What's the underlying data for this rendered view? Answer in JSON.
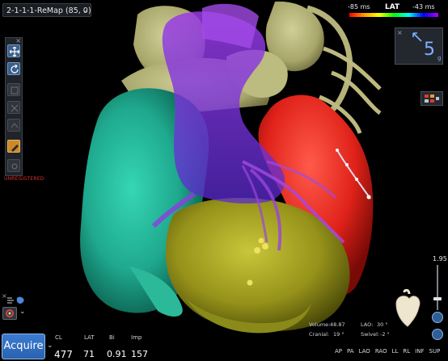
{
  "map_selector": {
    "label": "2-1-1-1-ReMap (85, 0)",
    "chevron_icon": "chevron-down-icon"
  },
  "toolbar": {
    "close_label": "×",
    "buttons": [
      {
        "icon": "pan-move-icon",
        "state": "on"
      },
      {
        "icon": "rotate-icon",
        "state": "on"
      },
      {
        "icon": "tool-disabled-icon",
        "state": "off"
      },
      {
        "icon": "tool-disabled-icon",
        "state": "off"
      },
      {
        "icon": "tool-disabled-icon",
        "state": "off"
      },
      {
        "icon": "pencil-icon",
        "state": "gold"
      },
      {
        "icon": "tool-disabled-icon",
        "state": "off"
      }
    ],
    "status_text": "UNREGISTERED"
  },
  "lat_scale": {
    "min_label": "-85 ms",
    "title": "LAT",
    "max_label": "-43 ms",
    "colors": [
      "#ff0000",
      "#ff9a00",
      "#ffff00",
      "#00ff00",
      "#00ffff",
      "#0000ff",
      "#b000ff"
    ]
  },
  "orientation": {
    "close_label": "×",
    "value": "5",
    "unit": "g",
    "arrow_icon": "arrow-up-left-icon"
  },
  "zoom": {
    "value": "1.95",
    "level_fraction": 0.25
  },
  "view_info": {
    "volume_label": "Volume:",
    "volume_value": "48.87",
    "lao_label": "LAO:",
    "lao_value": "30 °",
    "cranial_label": "Cranial:",
    "cranial_value": "19 °",
    "swivel_label": "Swivel:",
    "swivel_value": "-2 °"
  },
  "view_buttons": [
    "AP",
    "PA",
    "LAO",
    "RAO",
    "LL",
    "RL",
    "INF",
    "SUP"
  ],
  "bottom_left": {
    "close_label": "×",
    "chevron_icon": "chevron-down-icon"
  },
  "acquire": {
    "label": "Acquire"
  },
  "readouts": {
    "cl_label": "CL",
    "cl_value": "477",
    "lat_label": "LAT",
    "lat_value": "71",
    "bi_label": "Bi",
    "bi_value": "0.91",
    "imp_label": "Imp",
    "imp_value": "157"
  },
  "colors": {
    "background": "#000000",
    "accent": "#3b7bd0",
    "status_red": "#e0312a"
  }
}
